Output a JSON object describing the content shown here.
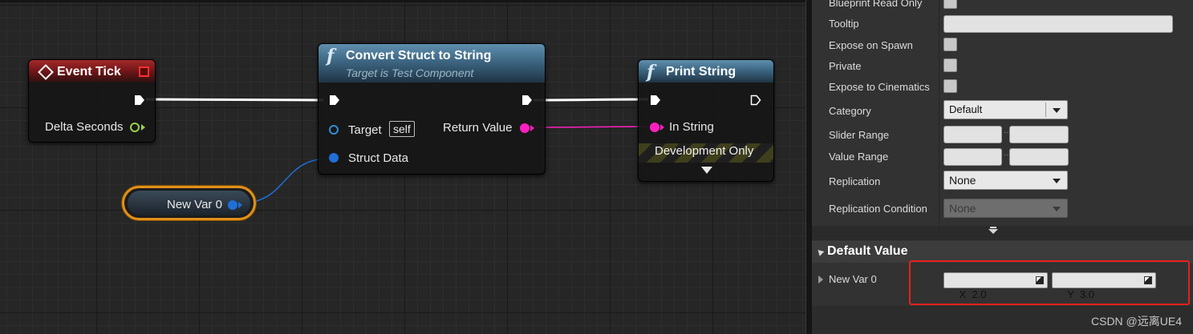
{
  "graph": {
    "event_tick": {
      "title": "Event Tick",
      "pin_delta": "Delta Seconds"
    },
    "convert_struct": {
      "title": "Convert Struct to String",
      "subtitle": "Target is Test Component",
      "pin_target": "Target",
      "self_label": "self",
      "pin_struct": "Struct Data",
      "pin_return": "Return Value"
    },
    "print_string": {
      "title": "Print String",
      "pin_in": "In String",
      "dev_only": "Development Only"
    },
    "var_node": {
      "label": "New Var 0"
    }
  },
  "details": {
    "rows": {
      "blueprint_read_only": "Blueprint Read Only",
      "tooltip": "Tooltip",
      "expose_on_spawn": "Expose on Spawn",
      "private": "Private",
      "expose_to_cinematics": "Expose to Cinematics",
      "category": "Category",
      "slider_range": "Slider Range",
      "value_range": "Value Range",
      "replication": "Replication",
      "replication_condition": "Replication Condition"
    },
    "category_value": "Default",
    "replication_value": "None",
    "replication_condition_value": "None",
    "default_value_section": "Default Value",
    "var_name": "New Var 0",
    "x_field": "X  2.0",
    "y_field": "Y  3.0"
  },
  "watermark": "CSDN @远离UE4",
  "colors": {
    "exec": "#ffffff",
    "float": "#9bd046",
    "object": "#2f8fd6",
    "struct": "#1f6fd6",
    "string": "#ff1fbf",
    "highlight": "#e8201c"
  }
}
